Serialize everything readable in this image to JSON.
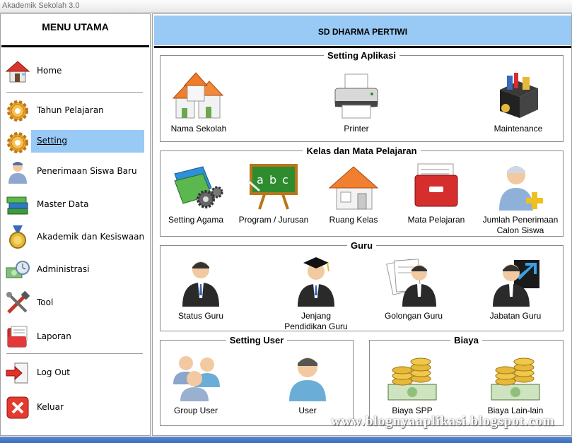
{
  "window": {
    "title": "Akademik Sekolah 3.0"
  },
  "menu": {
    "title": "MENU UTAMA",
    "items": [
      {
        "label": "Home"
      },
      {
        "label": "Tahun Pelajaran"
      },
      {
        "label": "Setting"
      },
      {
        "label": "Penerimaan Siswa Baru"
      },
      {
        "label": "Master Data"
      },
      {
        "label": "Akademik dan Kesiswaan"
      },
      {
        "label": "Administrasi"
      },
      {
        "label": "Tool"
      },
      {
        "label": "Laporan"
      },
      {
        "label": "Log Out"
      },
      {
        "label": "Keluar"
      }
    ],
    "selected": "Setting"
  },
  "header": {
    "school_name": "SD DHARMA PERTIWI"
  },
  "groups": {
    "setting_aplikasi": {
      "title": "Setting Aplikasi",
      "tiles": [
        {
          "label": "Nama Sekolah",
          "icon": "school-buildings-icon"
        },
        {
          "label": "Printer",
          "icon": "printer-icon"
        },
        {
          "label": "Maintenance",
          "icon": "toolbox-icon"
        }
      ]
    },
    "kelas_mapel": {
      "title": "Kelas dan Mata Pelajaran",
      "tiles": [
        {
          "label": "Setting Agama",
          "icon": "books-gears-icon"
        },
        {
          "label": "Program / Jurusan",
          "icon": "chalkboard-icon"
        },
        {
          "label": "Ruang Kelas",
          "icon": "house-icon"
        },
        {
          "label": "Mata Pelajaran",
          "icon": "red-folder-icon"
        },
        {
          "label": "Jumlah Penerimaan",
          "label2": "Calon Siswa",
          "icon": "user-add-icon"
        }
      ]
    },
    "guru": {
      "title": "Guru",
      "tiles": [
        {
          "label": "Status Guru",
          "icon": "businessman-icon"
        },
        {
          "label": "Jenjang",
          "label2": "Pendidikan Guru",
          "icon": "graduate-icon"
        },
        {
          "label": "Golongan Guru",
          "icon": "businessman-documents-icon"
        },
        {
          "label": "Jabatan Guru",
          "icon": "businessman-arrow-icon"
        }
      ]
    },
    "setting_user": {
      "title": "Setting User",
      "tiles": [
        {
          "label": "Group User",
          "icon": "user-group-icon"
        },
        {
          "label": "User",
          "icon": "user-icon"
        }
      ]
    },
    "biaya": {
      "title": "Biaya",
      "tiles": [
        {
          "label": "Biaya SPP",
          "icon": "coins-money-icon"
        },
        {
          "label": "Biaya Lain-lain",
          "icon": "coins-money-icon"
        }
      ]
    }
  },
  "watermark": "www.blognyaaplikasi.blogspot.com",
  "colors": {
    "accent": "#99c9f5",
    "taskbar": "#4a7cc4"
  }
}
